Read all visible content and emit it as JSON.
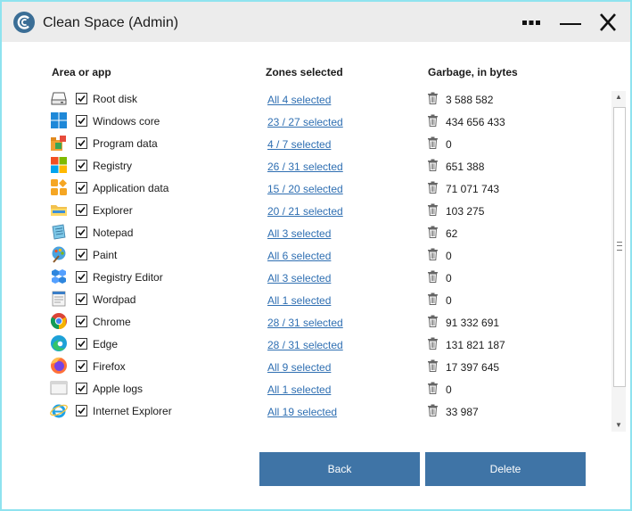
{
  "window": {
    "title": "Clean Space (Admin)"
  },
  "columns": {
    "area": "Area or app",
    "zones": "Zones selected",
    "garbage": "Garbage, in bytes"
  },
  "rows": [
    {
      "name": "Root disk",
      "zones": "All 4 selected",
      "bytes": "3 588 582",
      "icon": "drive-icon",
      "checked": true
    },
    {
      "name": "Windows core",
      "zones": "23 / 27 selected",
      "bytes": "434 656 433",
      "icon": "windows-icon",
      "checked": true
    },
    {
      "name": "Program data",
      "zones": "4 / 7 selected",
      "bytes": "0",
      "icon": "program-data-icon",
      "checked": true
    },
    {
      "name": "Registry",
      "zones": "26 / 31 selected",
      "bytes": "651 388",
      "icon": "registry-icon",
      "checked": true
    },
    {
      "name": "Application data",
      "zones": "15 / 20 selected",
      "bytes": "71 071 743",
      "icon": "application-data-icon",
      "checked": true
    },
    {
      "name": "Explorer",
      "zones": "20 / 21 selected",
      "bytes": "103 275",
      "icon": "folder-icon",
      "checked": true
    },
    {
      "name": "Notepad",
      "zones": "All 3 selected",
      "bytes": "62",
      "icon": "notepad-icon",
      "checked": true
    },
    {
      "name": "Paint",
      "zones": "All 6 selected",
      "bytes": "0",
      "icon": "paint-icon",
      "checked": true
    },
    {
      "name": "Registry Editor",
      "zones": "All 3 selected",
      "bytes": "0",
      "icon": "registry-editor-icon",
      "checked": true
    },
    {
      "name": "Wordpad",
      "zones": "All 1 selected",
      "bytes": "0",
      "icon": "wordpad-icon",
      "checked": true
    },
    {
      "name": "Chrome",
      "zones": "28 / 31 selected",
      "bytes": "91 332 691",
      "icon": "chrome-icon",
      "checked": true
    },
    {
      "name": "Edge",
      "zones": "28 / 31 selected",
      "bytes": "131 821 187",
      "icon": "edge-icon",
      "checked": true
    },
    {
      "name": "Firefox",
      "zones": "All 9 selected",
      "bytes": "17 397 645",
      "icon": "firefox-icon",
      "checked": true
    },
    {
      "name": "Apple logs",
      "zones": "All 1 selected",
      "bytes": "0",
      "icon": "window-icon",
      "checked": true
    },
    {
      "name": "Internet Explorer",
      "zones": "All 19 selected",
      "bytes": "33 987",
      "icon": "internet-explorer-icon",
      "checked": true
    }
  ],
  "buttons": {
    "back": "Back",
    "delete": "Delete"
  },
  "colors": {
    "accent": "#3f74a6",
    "link": "#2f6fb2",
    "border": "#8fe3ef",
    "titlebar": "#ececec"
  }
}
